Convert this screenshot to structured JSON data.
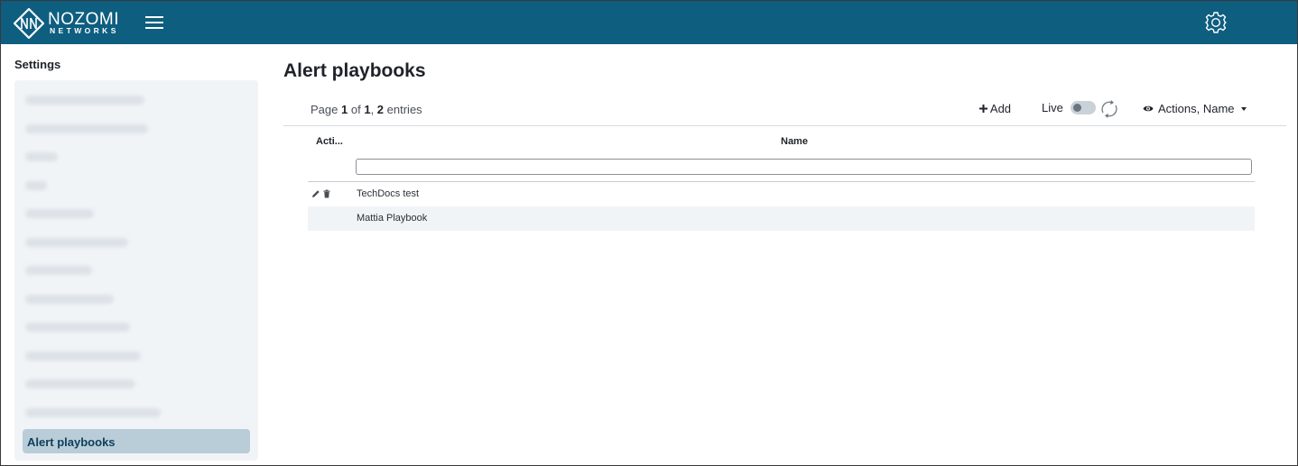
{
  "brand": {
    "name": "NOZOMI",
    "subname": "NETWORKS",
    "color": "#0e5e80"
  },
  "topbar": {
    "menu_icon": "hamburger-icon",
    "settings_icon": "gear-icon"
  },
  "sidebar": {
    "title": "Settings",
    "active_item": "Alert playbooks",
    "blurred_item_count": 12
  },
  "main": {
    "title": "Alert playbooks",
    "pager": {
      "prefix": "Page",
      "page": "1",
      "of": "of",
      "total_pages": "1",
      "entries": "2",
      "suffix": "entries"
    },
    "toolbar": {
      "add_label": "Add",
      "live_label": "Live",
      "live_on": false,
      "columns_label": "Actions, Name"
    },
    "table": {
      "columns": [
        "Acti...",
        "Name"
      ],
      "filter_value": "",
      "rows": [
        {
          "name": "TechDocs test",
          "actions": [
            "edit-icon",
            "trash-icon"
          ]
        },
        {
          "name": "Mattia Playbook",
          "actions": []
        }
      ]
    }
  }
}
